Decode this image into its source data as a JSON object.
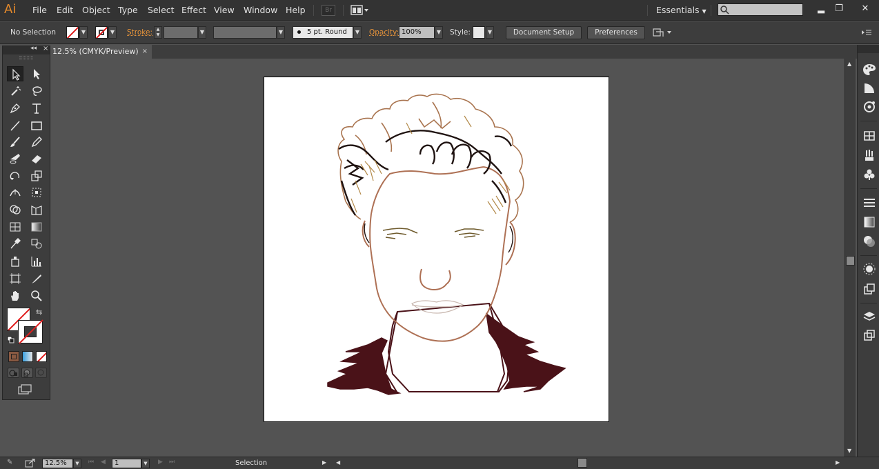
{
  "app": {
    "logo": "Ai",
    "workspace": "Essentials",
    "search_placeholder": "",
    "bridge_label": "Br"
  },
  "menu": {
    "items": [
      "File",
      "Edit",
      "Object",
      "Type",
      "Select",
      "Effect",
      "View",
      "Window",
      "Help"
    ]
  },
  "window_controls": {
    "minimize": "▂",
    "restore": "❐",
    "close": "✕"
  },
  "control_bar": {
    "selection_status": "No Selection",
    "stroke_label": "Stroke:",
    "brush": "5 pt. Round",
    "opacity_label": "Opacity:",
    "opacity_value": "100%",
    "style_label": "Style:",
    "document_setup": "Document Setup",
    "preferences": "Preferences"
  },
  "document": {
    "tab_title": "12.5% (CMYK/Preview)",
    "tab_close": "×"
  },
  "tools_panel": {
    "collapse": "◂◂",
    "close": "×",
    "swap_glyph": "⇆"
  },
  "status_bar": {
    "zoom": "12.5%",
    "artboard": "1",
    "current_tool": "Selection"
  },
  "colors": {
    "accent_orange": "#e8943a",
    "hair_brown": "#a9744f",
    "hair_dark": "#1f1311",
    "face_line": "#ae7155",
    "jacket_dark": "#4a1218",
    "brow_olive": "#6e5a2c"
  }
}
